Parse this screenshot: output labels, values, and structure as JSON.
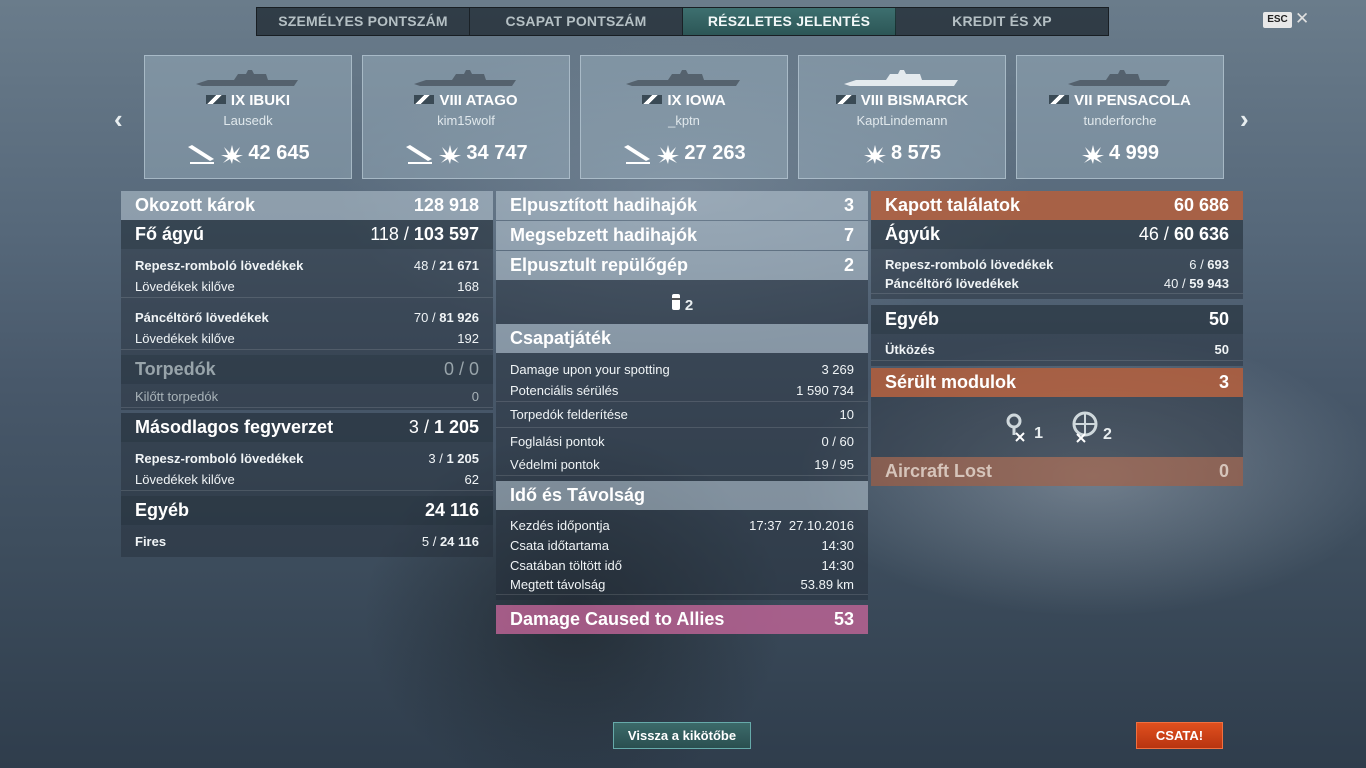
{
  "tabs": [
    "SZEMÉLYES PONTSZÁM",
    "CSAPAT PONTSZÁM",
    "RÉSZLETES JELENTÉS",
    "KREDIT ÉS XP"
  ],
  "esc_label": "ESC",
  "close_glyph": "✕",
  "nav": {
    "prev": "‹",
    "next": "›"
  },
  "ships": [
    {
      "name": "IX IBUKI",
      "player": "Lausedk",
      "damage": "42 645"
    },
    {
      "name": "VIII ATAGO",
      "player": "kim15wolf",
      "damage": "34 747"
    },
    {
      "name": "IX IOWA",
      "player": "_kptn",
      "damage": "27 263"
    },
    {
      "name": "VIII BISMARCK",
      "player": "KaptLindemann",
      "damage": "8 575"
    },
    {
      "name": "VII PENSACOLA",
      "player": "tunderforche",
      "damage": "4 999"
    }
  ],
  "left": {
    "damage": {
      "label": "Okozott károk",
      "value": "128 918"
    },
    "main": {
      "label": "Fő ágyú",
      "hits": "118",
      "value": "103 597"
    },
    "he": {
      "label": "Repesz-romboló lövedékek",
      "hits": "48",
      "value": "21 671"
    },
    "he_fired": {
      "label": "Lövedékek kilőve",
      "value": "168"
    },
    "ap": {
      "label": "Páncéltörő lövedékek",
      "hits": "70",
      "value": "81 926"
    },
    "ap_fired": {
      "label": "Lövedékek kilőve",
      "value": "192"
    },
    "torp": {
      "label": "Torpedók",
      "value": "0 / 0"
    },
    "torp_fired": {
      "label": "Kilőtt torpedók",
      "value": "0"
    },
    "secondary": {
      "label": "Másodlagos fegyverzet",
      "hits": "3",
      "value": "1 205"
    },
    "sec_he": {
      "label": "Repesz-romboló lövedékek",
      "hits": "3",
      "value": "1 205"
    },
    "sec_fired": {
      "label": "Lövedékek kilőve",
      "value": "62"
    },
    "other": {
      "label": "Egyéb",
      "value": "24 116"
    },
    "fires": {
      "label": "Fires",
      "hits": "5",
      "value": "24 116"
    }
  },
  "middle": {
    "destroyed": {
      "label": "Elpusztított hadihajók",
      "value": "3"
    },
    "damaged": {
      "label": "Megsebzett hadihajók",
      "value": "7"
    },
    "planes": {
      "label": "Elpusztult repülőgép",
      "value": "2"
    },
    "planes_icon_count": "2",
    "team": {
      "label": "Csapatjáték",
      "rows": [
        {
          "label": "Damage upon your spotting",
          "value": "3 269"
        },
        {
          "label": "Potenciális sérülés",
          "value": "1 590 734"
        },
        {
          "label": "Torpedók felderítése",
          "value": "10"
        },
        {
          "label": "Foglalási pontok",
          "value": "0 / 60"
        },
        {
          "label": "Védelmi pontok",
          "value": "19 / 95"
        }
      ]
    },
    "time": {
      "label": "Idő és Távolság",
      "rows": [
        {
          "label": "Kezdés időpontja",
          "value": "17:37  27.10.2016"
        },
        {
          "label": "Csata időtartama",
          "value": "14:30"
        },
        {
          "label": "Csatában töltött idő",
          "value": "14:30"
        },
        {
          "label": "Megtett távolság",
          "value": "53.89 km"
        }
      ]
    },
    "allies": {
      "label": "Damage Caused to Allies",
      "value": "53"
    }
  },
  "right": {
    "received": {
      "label": "Kapott találatok",
      "value": "60 686"
    },
    "guns": {
      "label": "Ágyúk",
      "hits": "46",
      "value": "60 636"
    },
    "he": {
      "label": "Repesz-romboló lövedékek",
      "hits": "6",
      "value": "693"
    },
    "ap": {
      "label": "Páncéltörő lövedékek",
      "hits": "40",
      "value": "59 943"
    },
    "other": {
      "label": "Egyéb",
      "value": "50"
    },
    "ram": {
      "label": "Ütközés",
      "value": "50"
    },
    "modules": {
      "label": "Sérült modulok",
      "value": "3"
    },
    "module_counts": [
      "1",
      "2"
    ],
    "aircraft": {
      "label": "Aircraft Lost",
      "value": "0"
    }
  },
  "buttons": {
    "back": "Vissza a kikötőbe",
    "battle": "CSATA!"
  }
}
